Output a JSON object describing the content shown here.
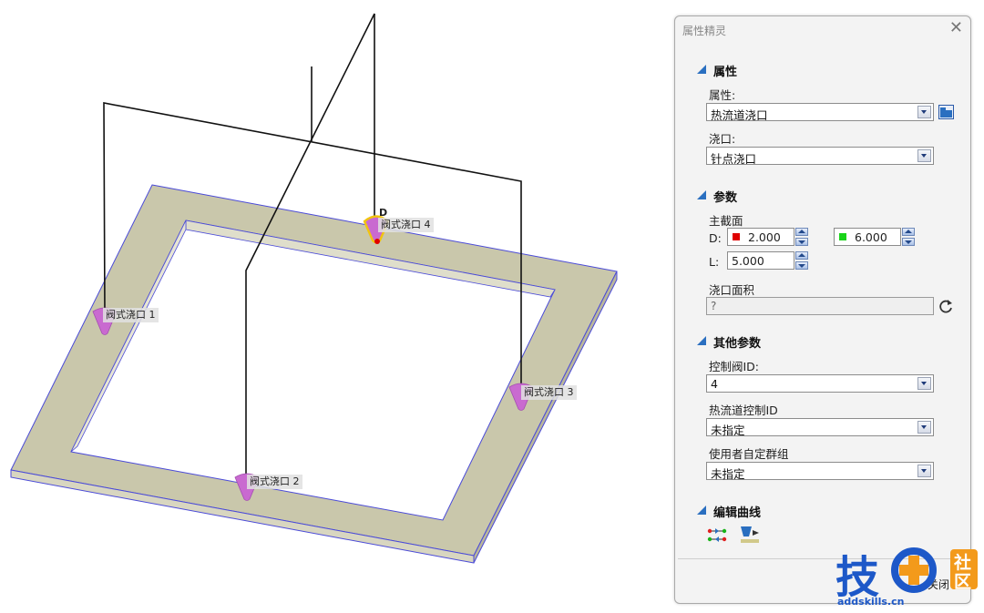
{
  "viewport": {
    "gates": [
      {
        "label": "阀式浇口 1"
      },
      {
        "label": "阀式浇口 2"
      },
      {
        "label": "阀式浇口 3"
      },
      {
        "label": "阀式浇口 4"
      }
    ],
    "marker_letter": "D"
  },
  "panel": {
    "title": "属性精灵",
    "close_glyph": "✕",
    "sections": {
      "attributes": "属性",
      "params": "参数",
      "other_params": "其他参数",
      "edit_curve": "编辑曲线"
    },
    "attr_label": "属性:",
    "attr_value": "热流道浇口",
    "gate_label": "浇口:",
    "gate_value": "针点浇口",
    "main_section_label": "主截面",
    "d_label": "D:",
    "d_value": "2.000",
    "d2_value": "6.000",
    "l_label": "L:",
    "l_value": "5.000",
    "gate_area_label": "浇口面积",
    "gate_area_value": "?",
    "valve_id_label": "控制阀ID:",
    "valve_id_value": "4",
    "hotrunner_id_label": "热流道控制ID",
    "hotrunner_id_value": "未指定",
    "group_label": "使用者自定群组",
    "group_value": "未指定",
    "close_button": "关闭"
  },
  "watermark": {
    "char1": "技",
    "char3": "社",
    "char4": "区",
    "url": "addskills.cn"
  },
  "colors": {
    "swatch_red": "#e00000",
    "swatch_green": "#19d419",
    "accent_blue": "#2a6fc0",
    "gate_pink": "#c96ad0",
    "plate_fill": "#c9c7ab",
    "watermark_blue": "#1d58c8",
    "watermark_orange": "#f39a1b"
  }
}
